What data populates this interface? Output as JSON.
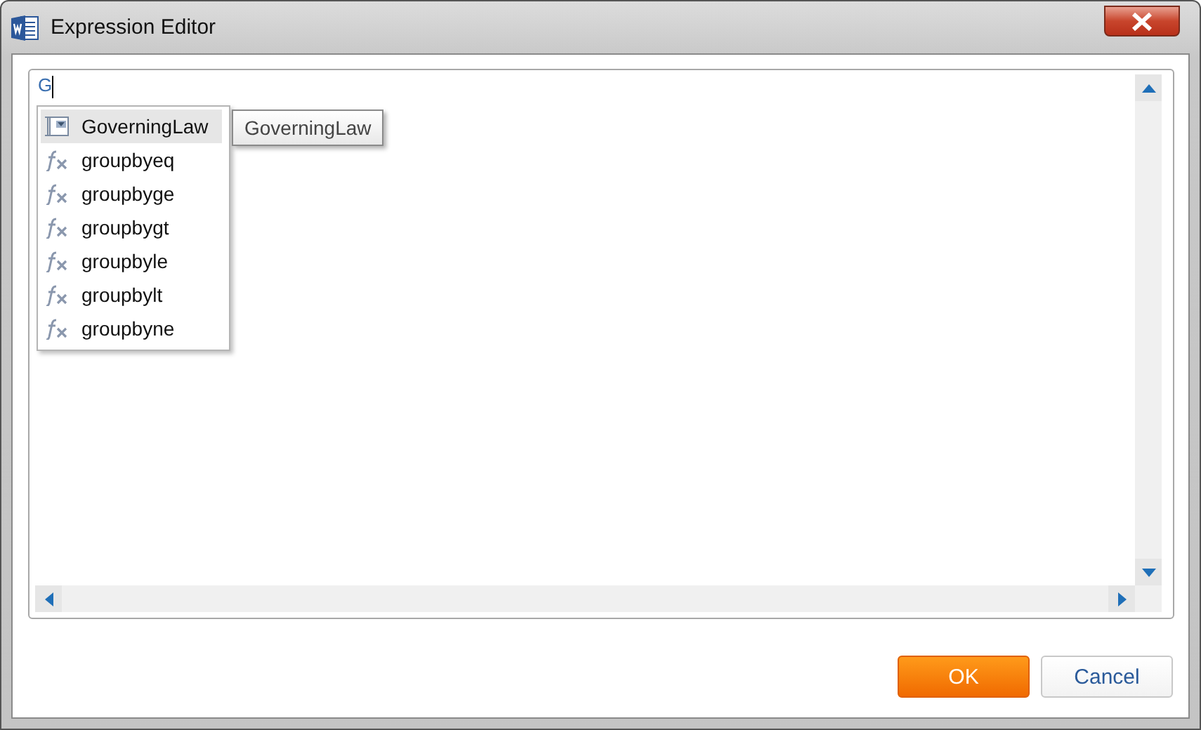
{
  "window": {
    "title": "Expression Editor"
  },
  "editor": {
    "value": "G"
  },
  "completion": {
    "items": [
      {
        "label": "GoverningLaw",
        "kind": "field",
        "selected": true
      },
      {
        "label": "groupbyeq",
        "kind": "function",
        "selected": false
      },
      {
        "label": "groupbyge",
        "kind": "function",
        "selected": false
      },
      {
        "label": "groupbygt",
        "kind": "function",
        "selected": false
      },
      {
        "label": "groupbyle",
        "kind": "function",
        "selected": false
      },
      {
        "label": "groupbylt",
        "kind": "function",
        "selected": false
      },
      {
        "label": "groupbyne",
        "kind": "function",
        "selected": false
      }
    ]
  },
  "tooltip": {
    "text": "GoverningLaw"
  },
  "buttons": [
    {
      "label": "OK",
      "kind": "primary"
    },
    {
      "label": "Cancel",
      "kind": "secondary"
    }
  ]
}
